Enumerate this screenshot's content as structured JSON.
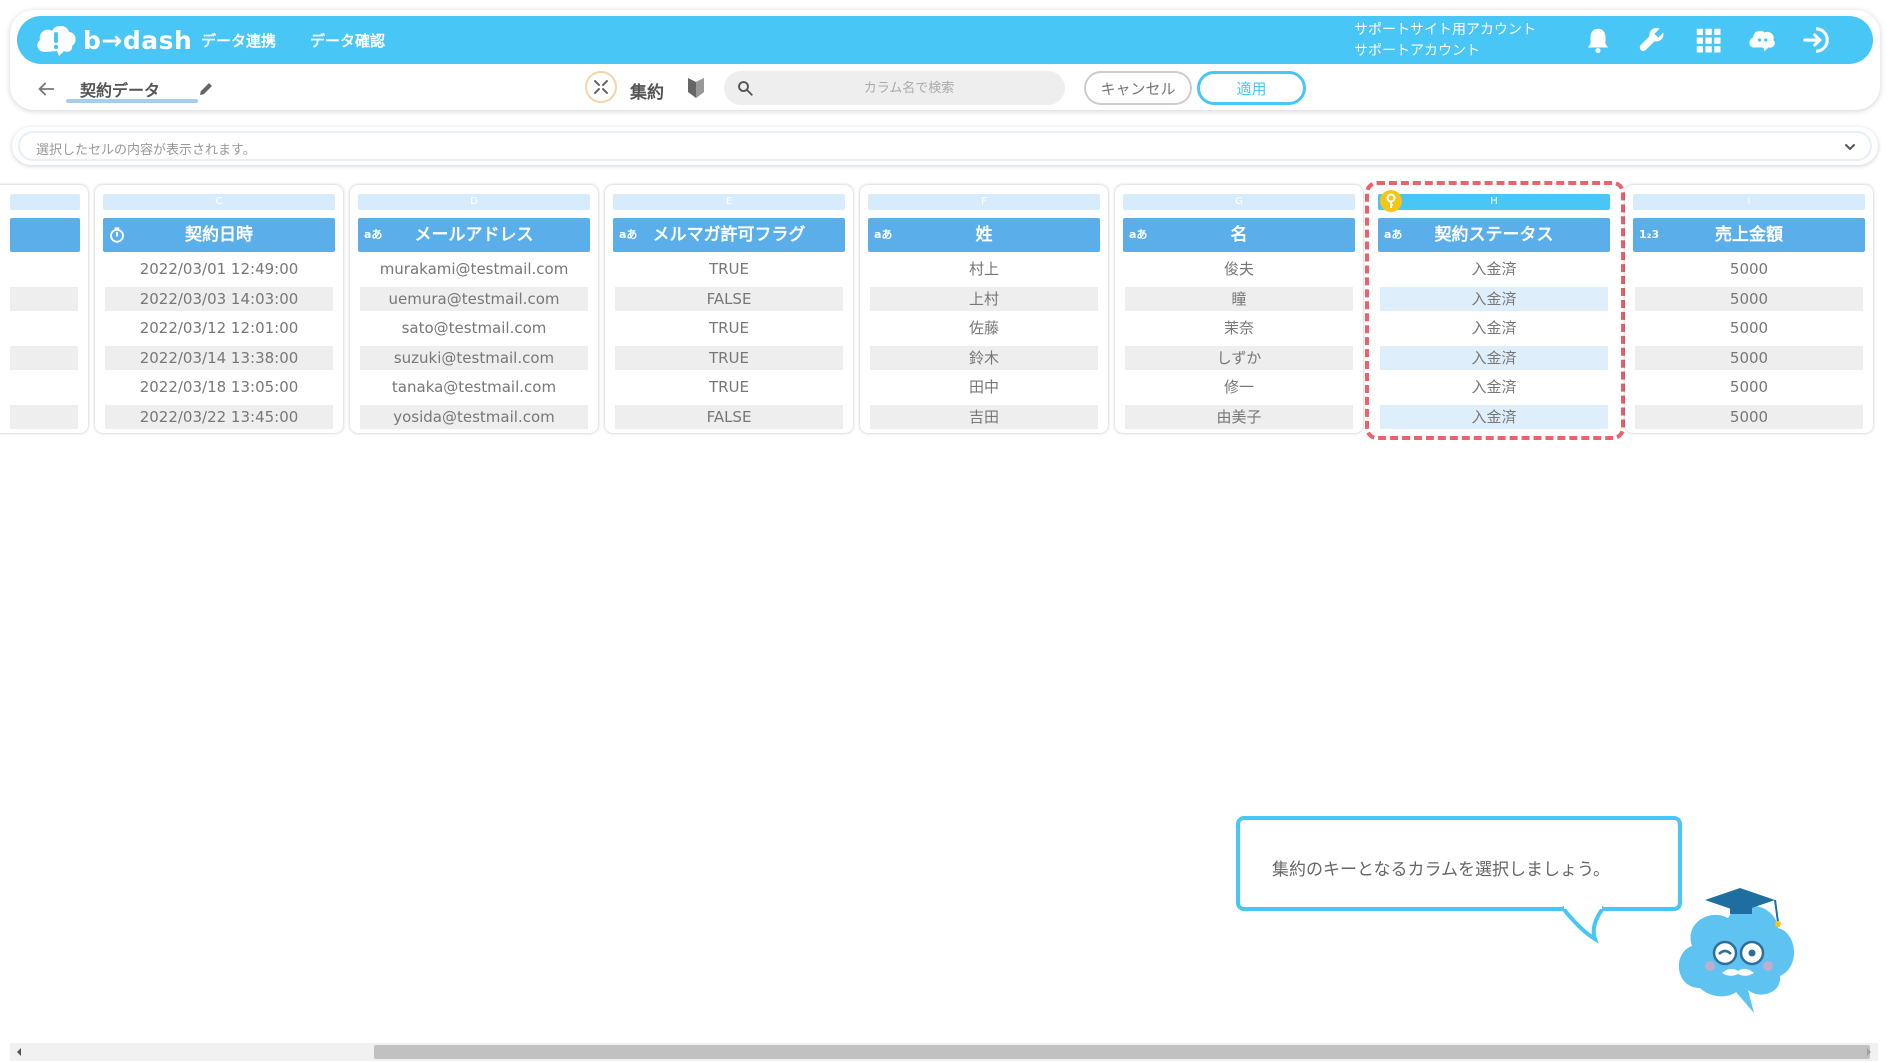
{
  "app": {
    "logo_text": "b→dash"
  },
  "nav": {
    "data_link": "データ連携",
    "data_check": "データ確認"
  },
  "account": {
    "line1": "サポートサイト用アカウント",
    "line2": "サポートアカウント"
  },
  "toolbar": {
    "dataset_name": "契約データ",
    "mode_label": "集約",
    "search_placeholder": "カラム名で検索",
    "cancel_label": "キャンセル",
    "apply_label": "適用"
  },
  "cell_bar": {
    "text": "選択したセルの内容が表示されます。"
  },
  "columns": [
    {
      "letter": "C",
      "header": "契約日時",
      "type": "datetime",
      "cells": [
        "2022/03/01 12:49:00",
        "2022/03/03 14:03:00",
        "2022/03/12 12:01:00",
        "2022/03/14 13:38:00",
        "2022/03/18 13:05:00",
        "2022/03/22 13:45:00"
      ]
    },
    {
      "letter": "D",
      "header": "メールアドレス",
      "type": "aあ",
      "cells": [
        "murakami@testmail.com",
        "uemura@testmail.com",
        "sato@testmail.com",
        "suzuki@testmail.com",
        "tanaka@testmail.com",
        "yosida@testmail.com"
      ]
    },
    {
      "letter": "E",
      "header": "メルマガ許可フラグ",
      "type": "aあ",
      "cells": [
        "TRUE",
        "FALSE",
        "TRUE",
        "TRUE",
        "TRUE",
        "FALSE"
      ]
    },
    {
      "letter": "F",
      "header": "姓",
      "type": "aあ",
      "cells": [
        "村上",
        "上村",
        "佐藤",
        "鈴木",
        "田中",
        "吉田"
      ]
    },
    {
      "letter": "G",
      "header": "名",
      "type": "aあ",
      "cells": [
        "俊夫",
        "瞳",
        "茉奈",
        "しずか",
        "修一",
        "由美子"
      ]
    },
    {
      "letter": "H",
      "header": "契約ステータス",
      "type": "aあ",
      "cells": [
        "入金済",
        "入金済",
        "入金済",
        "入金済",
        "入金済",
        "入金済"
      ]
    },
    {
      "letter": "I",
      "header": "売上金額",
      "type": "1₂3",
      "cells": [
        "5000",
        "5000",
        "5000",
        "5000",
        "5000",
        "5000"
      ]
    }
  ],
  "tooltip": {
    "text": "集約のキーとなるカラムを選択しましょう。"
  },
  "colors": {
    "brand": "#48c6f5",
    "header_blue": "#5aaeea",
    "highlight": "#e8636b"
  }
}
